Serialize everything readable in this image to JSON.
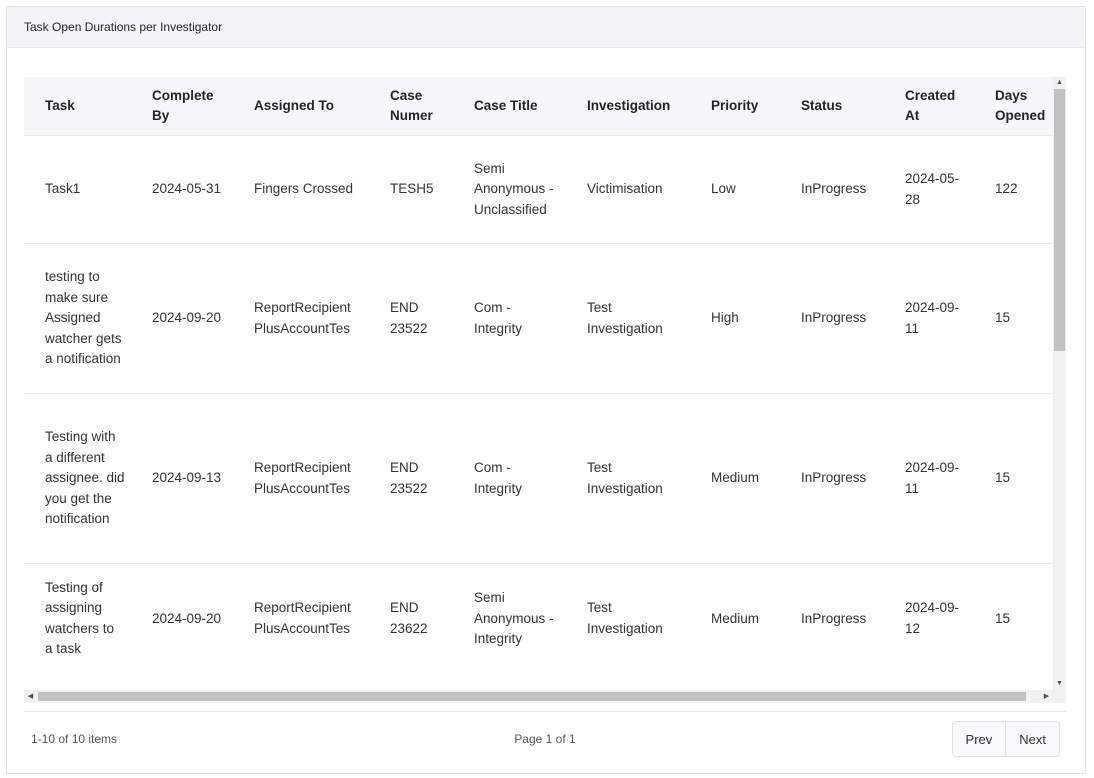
{
  "panel": {
    "title": "Task Open Durations per Investigator"
  },
  "table": {
    "columns": [
      "Task",
      "Complete By",
      "Assigned To",
      "Case Numer",
      "Case Title",
      "Investigation",
      "Priority",
      "Status",
      "Created At",
      "Days Opened"
    ],
    "rows": [
      [
        "Task1",
        "2024-05-31",
        "Fingers Crossed",
        "TESH5",
        "Semi Anonymous - Unclassified",
        "Victimisation",
        "Low",
        "InProgress",
        "2024-05-28",
        "122"
      ],
      [
        "testing to make sure Assigned watcher gets a notification",
        "2024-09-20",
        "ReportRecipient PlusAccountTes",
        "END 23522",
        "Com - Integrity",
        "Test Investigation",
        "High",
        "InProgress",
        "2024-09-11",
        "15"
      ],
      [
        "Testing with a different assignee. did you get the notification",
        "2024-09-13",
        "ReportRecipient PlusAccountTes",
        "END 23522",
        "Com - Integrity",
        "Test Investigation",
        "Medium",
        "InProgress",
        "2024-09-11",
        "15"
      ],
      [
        "Testing of assigning watchers to a task",
        "2024-09-20",
        "ReportRecipient PlusAccountTes",
        "END 23622",
        "Semi Anonymous - Integrity",
        "Test Investigation",
        "Medium",
        "InProgress",
        "2024-09-12",
        "15"
      ]
    ]
  },
  "footer": {
    "items_count": "1-10 of 10 items",
    "page_info": "Page 1 of 1",
    "prev_label": "Prev",
    "next_label": "Next"
  },
  "icons": {
    "scroll_up": "up-triangle",
    "scroll_down": "down-triangle",
    "scroll_left": "left-triangle",
    "scroll_right": "right-triangle"
  }
}
